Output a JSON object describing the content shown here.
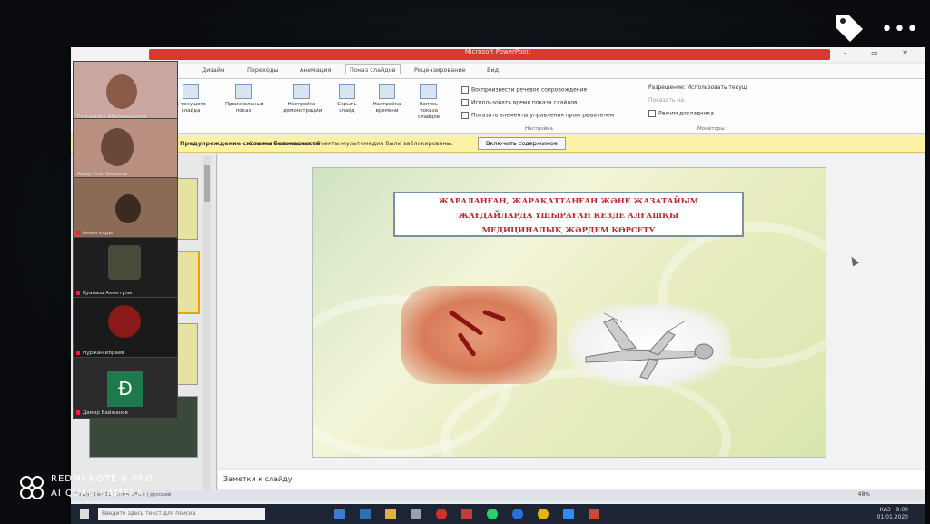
{
  "window": {
    "title": "Microsoft PowerPoint",
    "controls": "– ▭ ✕"
  },
  "ribbon_tabs": [
    {
      "label": "Дизайн"
    },
    {
      "label": "Переходы"
    },
    {
      "label": "Анимация"
    },
    {
      "label": "Показ слайдов",
      "active": true
    },
    {
      "label": "Рецензирование"
    },
    {
      "label": "Вид"
    }
  ],
  "ribbon": {
    "buttons": [
      {
        "label": "С текущего слайда",
        "icon": "slideshow-icon"
      },
      {
        "label": "Произвольный показ",
        "icon": "custom-show-icon"
      },
      {
        "label": "Настройка демонстрации",
        "icon": "setup-icon"
      },
      {
        "label": "Скрыть слайд",
        "icon": "hide-slide-icon"
      },
      {
        "label": "Настройка времени",
        "icon": "timing-icon"
      },
      {
        "label": "Запись показа слайдов",
        "icon": "record-icon"
      }
    ],
    "checks": [
      {
        "label": "Воспроизвести речевое сопровождение"
      },
      {
        "label": "Использовать время показа слайдов"
      },
      {
        "label": "Показать элементы управления проигрывателем"
      }
    ],
    "groups": {
      "setup": "Настройка",
      "monitors": "Мониторы"
    },
    "resolution_label": "Разрешение:",
    "resolution_value": "Использовать текущ",
    "monitor_label": "Показать на:",
    "presenter_view": "Режим докладчика"
  },
  "security_bar": {
    "title": "Предупреждение системы безопасности",
    "message": "Ссылки на внешние объекты мультимедиа были заблокированы.",
    "button": "Включить содержимое"
  },
  "slide": {
    "banner_lines": [
      "ЖАРАЛАНҒАН, ЖАРАҚАТТАНҒАН ЖӘНЕ ЖАЗАТАЙЫМ",
      "ЖАҒДАЙЛАРДА ҰШЫРАҒАН КЕЗДЕ АЛҒАШҚЫ",
      "МЕДИЦИНАЛЫҚ ЖӘРДЕМ КӨРСЕТУ"
    ]
  },
  "notes": {
    "placeholder": "Заметки к слайду"
  },
  "status": {
    "left": "Слайд 3 из 21  |  Тема Office  |  русский",
    "zoom": "48%"
  },
  "taskbar": {
    "search_placeholder": "Введите здесь текст для поиска",
    "lang": "КАЗ",
    "time": "9:00",
    "date": "01.01.2020"
  },
  "participants": [
    {
      "name": "Гульфайра Абылкасымова",
      "tile_color": "#c9a6a0"
    },
    {
      "name": "Ажар Сейтбековна",
      "tile_color": "#b99080"
    },
    {
      "name": "Амангелды",
      "tile_color": "#8d6a55"
    },
    {
      "name": "Қуаныш Ахметұлы",
      "tile_color": "#3a3a2a"
    },
    {
      "name": "Нұржан Ибраев",
      "tile_color": "#1f1f1f"
    },
    {
      "name": "Дамир Байжанов",
      "tile_color": "#2b2b2b",
      "letter": "Đ"
    }
  ],
  "overlay": {
    "more": "•••"
  },
  "watermark": {
    "line1": "REDMI NOTE 8 PRO",
    "line2": "AI QUAD CAMERA"
  }
}
